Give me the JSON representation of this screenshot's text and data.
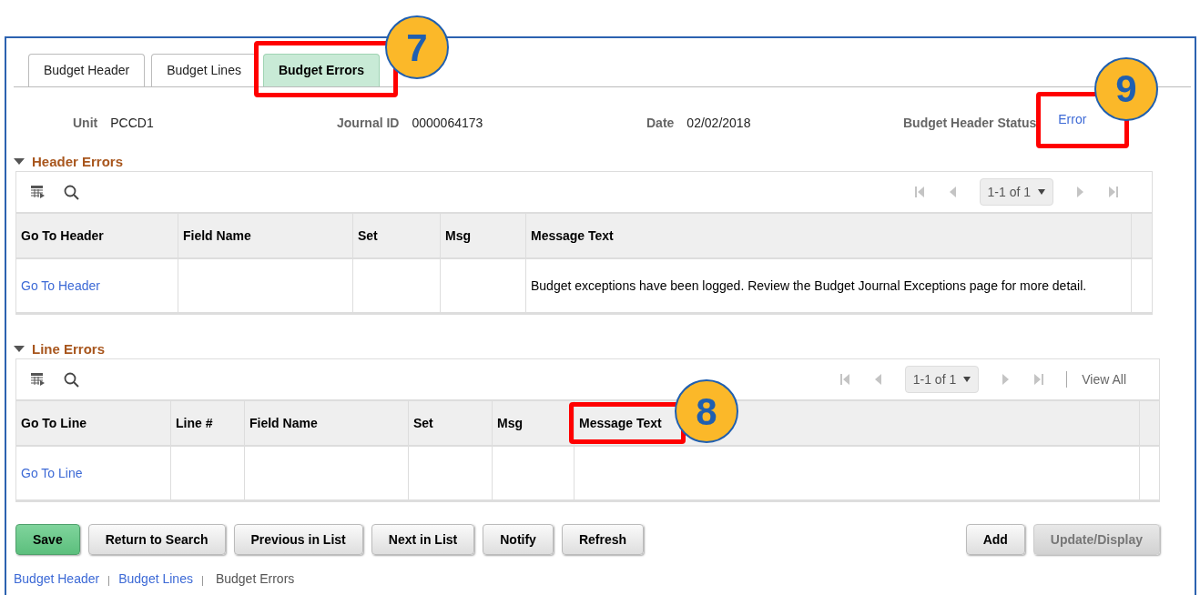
{
  "tabs": [
    {
      "label": "Budget Header",
      "selected": false
    },
    {
      "label": "Budget Lines",
      "selected": false
    },
    {
      "label": "Budget Errors",
      "selected": true,
      "callout": "7"
    }
  ],
  "fields": [
    {
      "label": "Unit",
      "value": "PCCD1"
    },
    {
      "label": "Journal ID",
      "value": "0000064173"
    },
    {
      "label": "Date",
      "value": "02/02/2018"
    }
  ],
  "status": {
    "label": "Budget Header Status",
    "value": "Error",
    "callout": "9"
  },
  "header_errors": {
    "title": "Header Errors",
    "pager": "1-1 of 1",
    "columns": [
      {
        "label": "Go To Header"
      },
      {
        "label": "Field Name"
      },
      {
        "label": "Set"
      },
      {
        "label": "Msg"
      },
      {
        "label": "Message Text"
      }
    ],
    "rows": [
      {
        "cells": [
          {
            "text": "Go To Header",
            "kind": "link"
          },
          {
            "text": ""
          },
          {
            "text": ""
          },
          {
            "text": ""
          },
          {
            "text": "Budget exceptions have been logged. Review the Budget Journal Exceptions page for more detail.",
            "kind": "text"
          }
        ]
      }
    ]
  },
  "line_errors": {
    "title": "Line Errors",
    "pager": "1-1 of 1",
    "view_all": "View All",
    "columns": [
      {
        "label": "Go To Line"
      },
      {
        "label": "Line #"
      },
      {
        "label": "Field Name"
      },
      {
        "label": "Set"
      },
      {
        "label": "Msg"
      },
      {
        "label": "Message Text",
        "callout": "8"
      }
    ],
    "rows": [
      {
        "cells": [
          {
            "text": "Go To Line",
            "kind": "link"
          },
          {
            "text": ""
          },
          {
            "text": ""
          },
          {
            "text": ""
          },
          {
            "text": ""
          },
          {
            "text": ""
          }
        ]
      }
    ]
  },
  "buttons_left": [
    {
      "label": "Save",
      "kind": "primary"
    },
    {
      "label": "Return to Search",
      "kind": "normal"
    },
    {
      "label": "Previous in List",
      "kind": "normal"
    },
    {
      "label": "Next in List",
      "kind": "normal"
    },
    {
      "label": "Notify",
      "kind": "normal"
    },
    {
      "label": "Refresh",
      "kind": "normal"
    }
  ],
  "buttons_right": [
    {
      "label": "Add",
      "kind": "normal"
    },
    {
      "label": "Update/Display",
      "kind": "disabled"
    }
  ],
  "footer_links": [
    {
      "label": "Budget Header",
      "selected": false
    },
    {
      "label": "Budget Lines",
      "selected": false
    },
    {
      "label": "Budget Errors",
      "selected": true
    }
  ]
}
